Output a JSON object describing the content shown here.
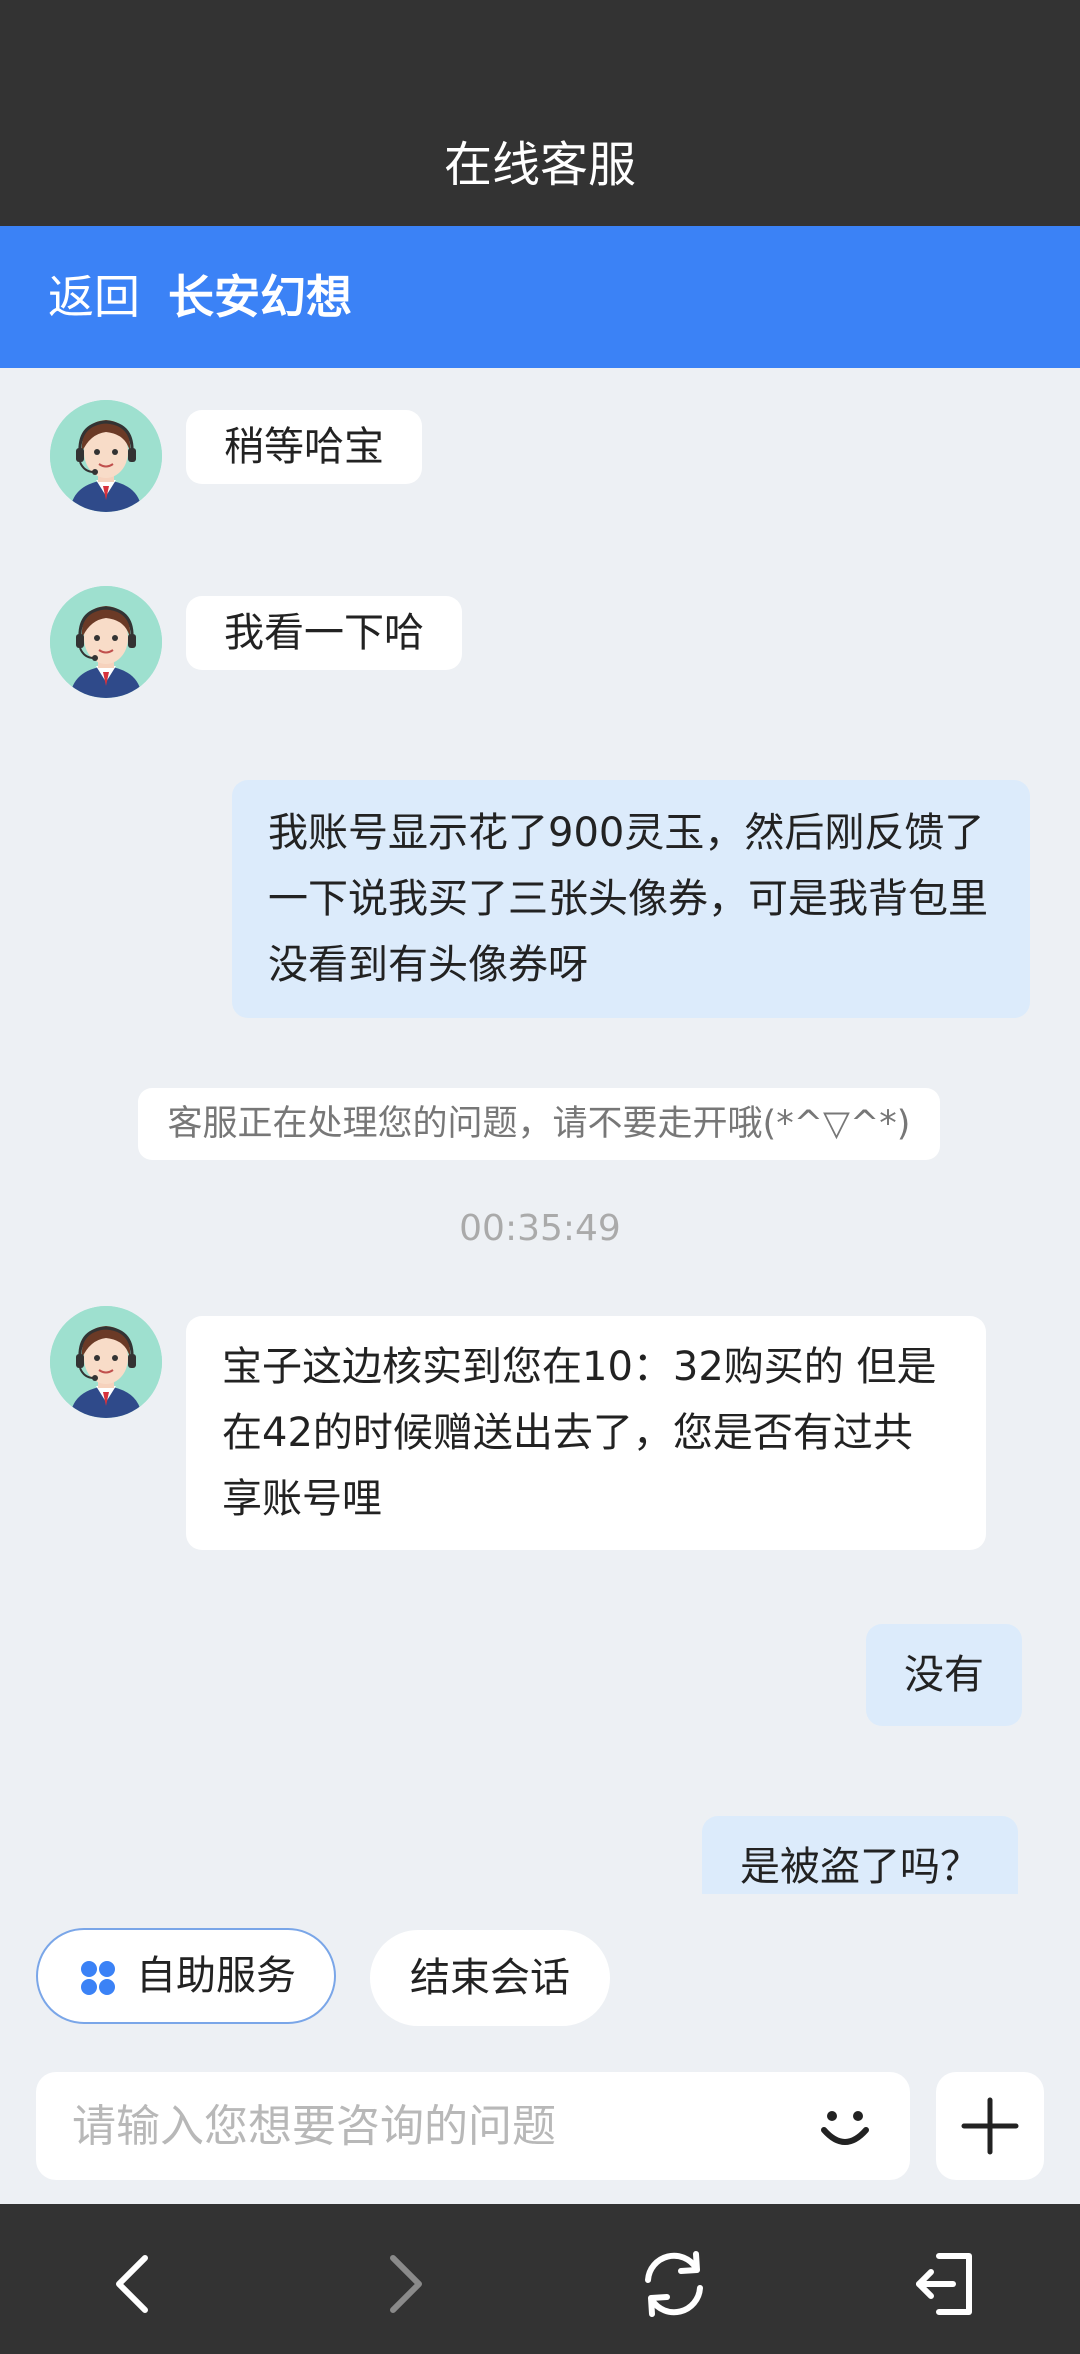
{
  "window": {
    "title": "在线客服"
  },
  "header": {
    "back_label": "返回",
    "game_name": "长安幻想"
  },
  "chat": {
    "messages": [
      {
        "text": "稍等哈宝"
      },
      {
        "text": "我看一下哈"
      },
      {
        "text": "我账号显示花了900灵玉，然后刚反馈了一下说我买了三张头像券，可是我背包里没看到有头像券呀"
      },
      {
        "text": "宝子这边核实到您在10：32购买的 但是在42的时候赠送出去了，您是否有过共享账号哩"
      },
      {
        "text": "没有"
      },
      {
        "text": "是被盗了吗？"
      }
    ],
    "notice": "客服正在处理您的问题，请不要走开哦(*^▽^*)",
    "timestamp": "00:35:49"
  },
  "quick_actions": {
    "self_service": "自助服务",
    "end_chat": "结束会话"
  },
  "input": {
    "placeholder": "请输入您想要咨询的问题",
    "value": ""
  },
  "icons": {
    "emoji": "smile-icon",
    "plus": "plus-icon",
    "back": "chevron-left-icon",
    "forward": "chevron-right-icon",
    "refresh": "refresh-icon",
    "exit": "exit-icon",
    "self_service": "grid-icon"
  },
  "colors": {
    "header_blue": "#3b82f6",
    "dark_bar": "#333333",
    "chat_bg": "#edf0f4",
    "user_bubble": "#dcebfb",
    "agent_bubble": "#ffffff"
  }
}
